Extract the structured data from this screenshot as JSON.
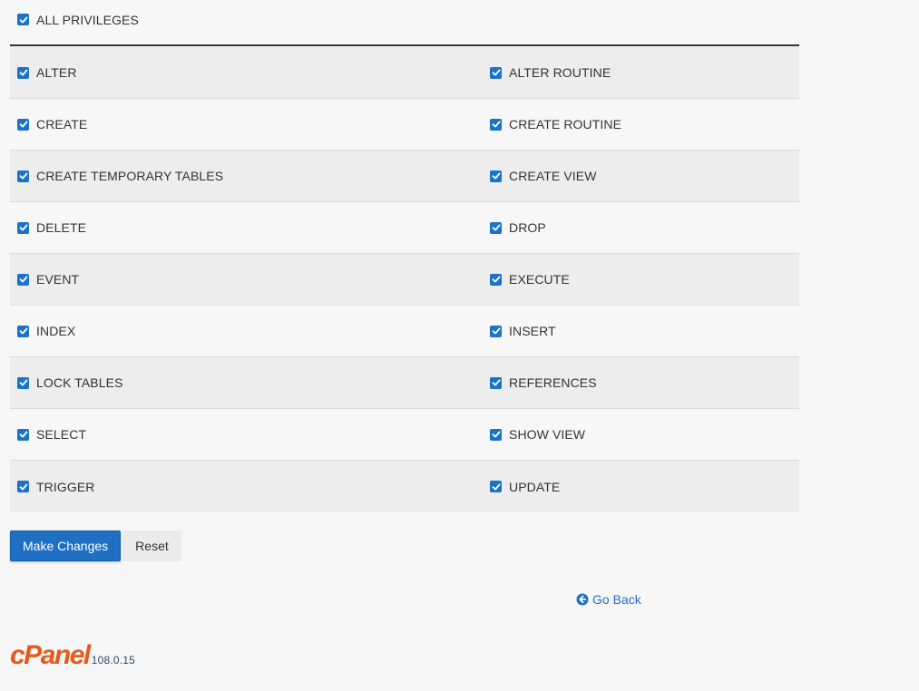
{
  "all_privileges": {
    "label": "ALL PRIVILEGES",
    "checked": true
  },
  "privileges": [
    {
      "left": "ALTER",
      "right": "ALTER ROUTINE"
    },
    {
      "left": "CREATE",
      "right": "CREATE ROUTINE"
    },
    {
      "left": "CREATE TEMPORARY TABLES",
      "right": "CREATE VIEW"
    },
    {
      "left": "DELETE",
      "right": "DROP"
    },
    {
      "left": "EVENT",
      "right": "EXECUTE"
    },
    {
      "left": "INDEX",
      "right": "INSERT"
    },
    {
      "left": "LOCK TABLES",
      "right": "REFERENCES"
    },
    {
      "left": "SELECT",
      "right": "SHOW VIEW"
    },
    {
      "left": "TRIGGER",
      "right": "UPDATE"
    }
  ],
  "buttons": {
    "make_changes": "Make Changes",
    "reset": "Reset"
  },
  "nav": {
    "go_back": "Go Back"
  },
  "footer": {
    "brand": "cPanel",
    "version": "108.0.15"
  },
  "colors": {
    "checkbox": "#1a73c8",
    "primary_button": "#1f6fc5",
    "link": "#1f6fc5",
    "brand": "#e8591a"
  },
  "icons": {
    "checkbox": "checkmark-icon",
    "go_back": "circle-arrow-left-icon"
  }
}
